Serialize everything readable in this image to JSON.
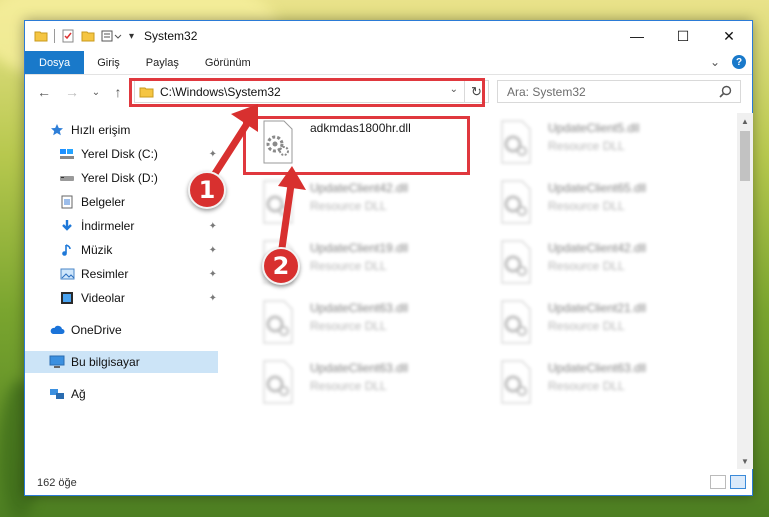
{
  "window": {
    "title": "System32",
    "controls": {
      "minimize": "—",
      "maximize": "☐",
      "close": "✕"
    }
  },
  "ribbon": {
    "tabs": [
      "Dosya",
      "Giriş",
      "Paylaş",
      "Görünüm"
    ],
    "expand_glyph": "⌄",
    "help_glyph": "?"
  },
  "nav": {
    "back": "←",
    "forward": "→",
    "recent": "⌄",
    "up": "↑"
  },
  "address": {
    "path": "C:\\Windows\\System32",
    "dropdown": "⌄",
    "refresh": "↻"
  },
  "search": {
    "placeholder": "Ara: System32"
  },
  "sidebar": {
    "quick_access": "Hızlı erişim",
    "items": [
      {
        "label": "Yerel Disk (C:)",
        "icon": "drive-icon",
        "pinned": true
      },
      {
        "label": "Yerel Disk (D:)",
        "icon": "drive-icon",
        "pinned": false
      },
      {
        "label": "Belgeler",
        "icon": "documents-icon",
        "pinned": true
      },
      {
        "label": "İndirmeler",
        "icon": "downloads-icon",
        "pinned": true
      },
      {
        "label": "Müzik",
        "icon": "music-icon",
        "pinned": true
      },
      {
        "label": "Resimler",
        "icon": "pictures-icon",
        "pinned": true
      },
      {
        "label": "Videolar",
        "icon": "videos-icon",
        "pinned": true
      }
    ],
    "onedrive": "OneDrive",
    "this_pc": "Bu bilgisayar",
    "network": "Ağ",
    "pin_glyph": "📌"
  },
  "files": [
    {
      "name": "adkmdas1800hr.dll",
      "type": "",
      "highlighted": true
    },
    {
      "name": "UpdateClient5.dll",
      "type": "Resource DLL"
    },
    {
      "name": "UpdateClient42.dll",
      "type": "Resource DLL"
    },
    {
      "name": "UpdateClient65.dll",
      "type": "Resource DLL"
    },
    {
      "name": "UpdateClient19.dll",
      "type": "Resource DLL"
    },
    {
      "name": "UpdateClient42.dll",
      "type": "Resource DLL"
    },
    {
      "name": "UpdateClient63.dll",
      "type": "Resource DLL"
    },
    {
      "name": "UpdateClient21.dll",
      "type": "Resource DLL"
    },
    {
      "name": "UpdateClient63.dll",
      "type": "Resource DLL"
    },
    {
      "name": "UpdateClient63.dll",
      "type": "Resource DLL"
    }
  ],
  "status": {
    "count": "162 öğe"
  },
  "annotations": {
    "step1": "1",
    "step2": "2",
    "color": "#d8302f"
  },
  "colors": {
    "accent": "#1979ca",
    "selection": "#cce4f7",
    "highlight_box": "#e0383e"
  }
}
